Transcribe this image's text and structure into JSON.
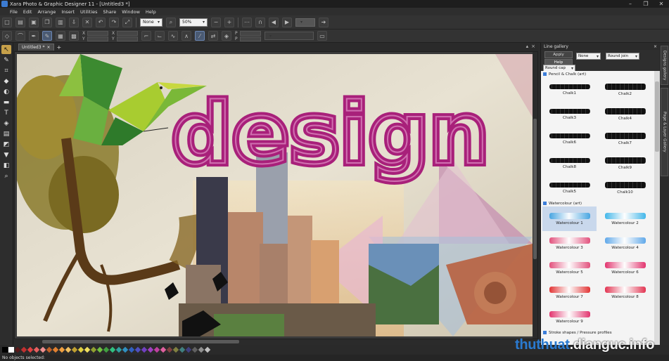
{
  "window": {
    "title": "Xara Photo & Graphic Designer 11 - [Untitled3 *]",
    "controls": [
      "–",
      "❐",
      "✕"
    ]
  },
  "menu": [
    "File",
    "Edit",
    "Arrange",
    "Insert",
    "Utilities",
    "Share",
    "Window",
    "Help"
  ],
  "toolbar": {
    "quality": "None",
    "zoom": "50%"
  },
  "coords": {
    "x1": "X",
    "y1": "Y",
    "x2": "X",
    "y2": "Y",
    "p": "P",
    "q": "P"
  },
  "document": {
    "tab_label": "Untitled3 *",
    "new_tab": "+"
  },
  "colors": {
    "accent": "#c7a14a",
    "palette": [
      "#000000",
      "#ffffff",
      "#5a1a1a",
      "#c03030",
      "#e04040",
      "#e86060",
      "#f09090",
      "#c06028",
      "#e08030",
      "#f0a040",
      "#f0c060",
      "#c0a030",
      "#e0d040",
      "#f0e060",
      "#90a030",
      "#70c040",
      "#40a040",
      "#30c080",
      "#30a0a0",
      "#3090c0",
      "#3060c0",
      "#5050c0",
      "#7040c0",
      "#a040c0",
      "#c040a0",
      "#e060a0",
      "#804040",
      "#808040",
      "#408080",
      "#404080",
      "#606060",
      "#909090",
      "#c0c0c0"
    ]
  },
  "gallery": {
    "title": "Line gallery",
    "btn_apply": "Apply",
    "btn_help": "Help",
    "sel_none": "None",
    "sel_round_join": "Round join",
    "sel_round_cap": "Round cap",
    "cat_pencil": "Pencil & Chalk (art)",
    "chalk": [
      "Chalk1",
      "Chalk2",
      "Chalk3",
      "Chalk4",
      "Chalk6",
      "Chalk7",
      "Chalk8",
      "Chalk9",
      "Chalk5",
      "Chalk10"
    ],
    "cat_water": "Watercolour (art)",
    "water": [
      "Watercolour 1",
      "Watercolour 2",
      "Watercolour 3",
      "Watercolour 4",
      "Watercolour 5",
      "Watercolour 6",
      "Watercolour 7",
      "Watercolour 8",
      "Watercolour 9"
    ],
    "cat_stroke": "Stroke shapes / Pressure profiles"
  },
  "sidetabs": {
    "designs": "Designs gallery",
    "page_layer": "Page & Layer Gallery"
  },
  "artwork": {
    "headline": "design"
  },
  "status": {
    "selection": "No objects selected:"
  },
  "watermark": {
    "part1": "thuthuat",
    "part2": ".dianguc.info"
  }
}
